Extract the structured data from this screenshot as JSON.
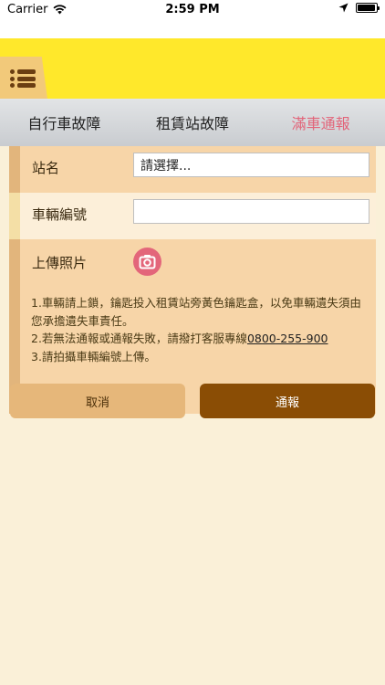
{
  "status_bar": {
    "carrier": "Carrier",
    "time": "2:59 PM",
    "battery_level": 0.95
  },
  "header": {
    "menu_icon": "menu-list-icon",
    "bg_color": "#FFE82B"
  },
  "tabs": [
    {
      "label": "自行車故障",
      "active": false
    },
    {
      "label": "租賃站故障",
      "active": false
    },
    {
      "label": "滿車通報",
      "active": true
    }
  ],
  "form": {
    "station_label": "站名",
    "station_value": "請選擇...",
    "bike_label": "車輛編號",
    "bike_value": "",
    "upload_label": "上傳照片",
    "camera_icon": "camera-icon",
    "notes": {
      "line1": "1.車輛請上鎖，鑰匙投入租賃站旁黃色鑰匙盒，以免車輛遺失須由您承擔遺失車責任。",
      "line2_prefix": "2.若無法通報或通報失敗，請撥打客服專線",
      "phone": "0800-255-900",
      "line3": "3.請拍攝車輛編號上傳。"
    }
  },
  "buttons": {
    "cancel": "取消",
    "report": "通報"
  },
  "colors": {
    "accent_active_tab": "#E2657A",
    "report_button": "#8A4D05",
    "cancel_button": "#E6B77A"
  }
}
